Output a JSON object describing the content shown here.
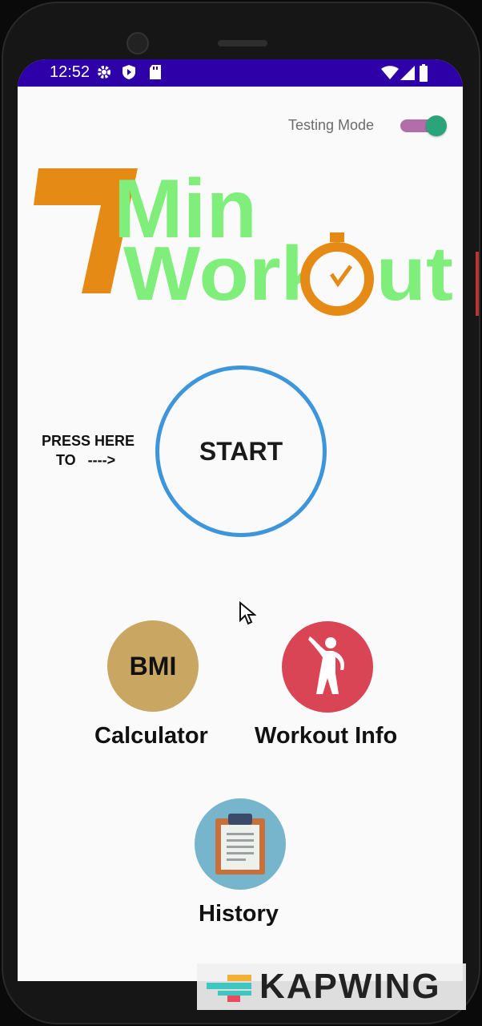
{
  "status_bar": {
    "time": "12:52",
    "icons": [
      "gear-icon",
      "shield-play-icon",
      "sd-card-icon",
      "wifi-icon",
      "signal-icon",
      "battery-icon"
    ],
    "background": "#2d00a8"
  },
  "testing_mode": {
    "label": "Testing Mode",
    "enabled": true
  },
  "logo": {
    "digit": "7",
    "line1": "Min",
    "line2": "Workout",
    "digit_color": "#e68a16",
    "text_color": "#7fee7b"
  },
  "start": {
    "hint_line1": "PRESS HERE",
    "hint_line2": "TO   ---->",
    "label": "START",
    "ring_color": "#3d96db"
  },
  "menu": {
    "bmi": {
      "icon_text": "BMI",
      "caption": "Calculator",
      "color": "#c9a661"
    },
    "workout_info": {
      "icon": "stretching-person-icon",
      "caption": "Workout Info",
      "color": "#d94554"
    },
    "history": {
      "icon": "clipboard-icon",
      "caption": "History",
      "color": "#77b5cc"
    }
  },
  "watermark": {
    "text": "KAPWING"
  }
}
